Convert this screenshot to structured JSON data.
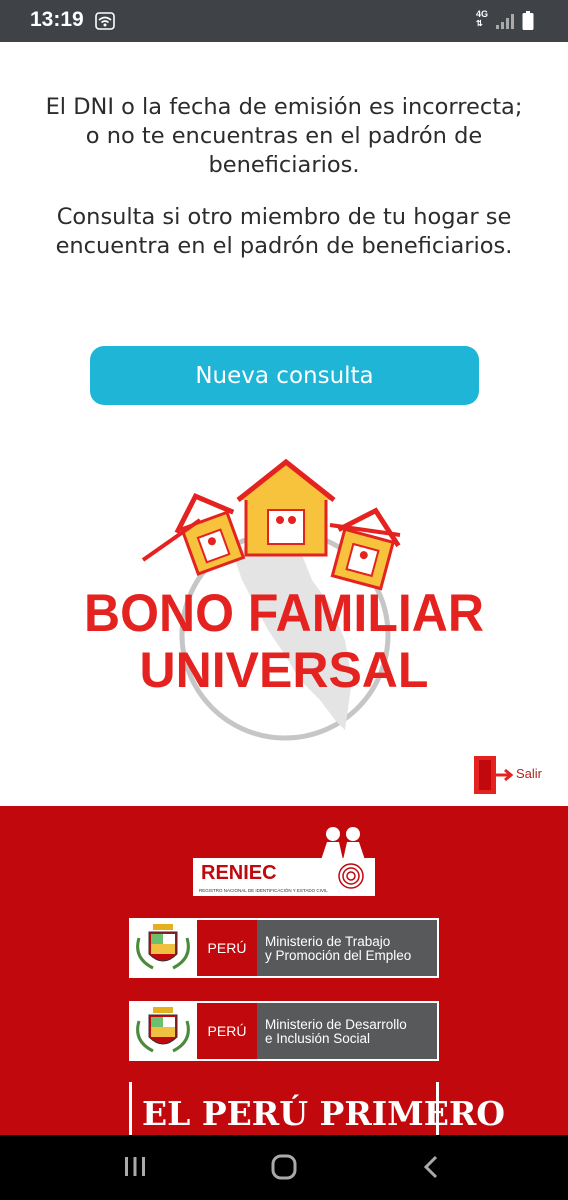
{
  "status_bar": {
    "time": "13:19",
    "network_label": "4G",
    "icons": [
      "wifi-icon",
      "signal-icon",
      "battery-icon"
    ]
  },
  "main": {
    "message_primary": "El DNI o la fecha de emisión es incorrecta; o no te encuentras en el padrón de beneficiarios.",
    "message_secondary": "Consulta si otro miembro de tu hogar se encuentra en el padrón de beneficiarios.",
    "button_label": "Nueva consulta",
    "logo_line1": "BONO FAMILIAR",
    "logo_line2": "UNIVERSAL",
    "exit_label": "Salir"
  },
  "footer": {
    "reniec_name": "RENIEC",
    "reniec_subtitle": "REGISTRO NACIONAL DE IDENTIFICACIÓN Y ESTADO CIVIL",
    "ministries": [
      {
        "country": "PERÚ",
        "line1": "Ministerio de Trabajo",
        "line2": "y Promoción del Empleo"
      },
      {
        "country": "PERÚ",
        "line1": "Ministerio de Desarrollo",
        "line2": "e Inclusión Social"
      }
    ],
    "slogan": "EL PERÚ PRIMERO"
  },
  "colors": {
    "accent_button": "#1fb5d6",
    "brand_red": "#e42320",
    "footer_red": "#c0080d",
    "ministry_gray": "#58595b"
  }
}
